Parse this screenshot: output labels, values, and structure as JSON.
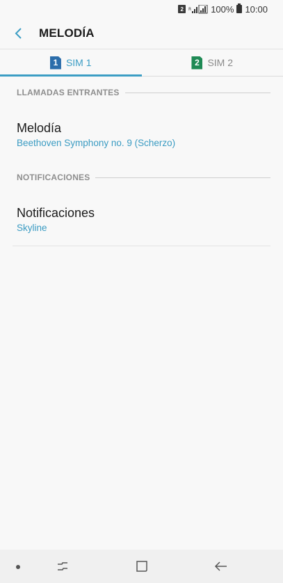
{
  "status_bar": {
    "sim_indicator": "2",
    "battery_percent": "100%",
    "time": "10:00",
    "icons": [
      "sim2-icon",
      "signal-icon",
      "battery-icon"
    ]
  },
  "header": {
    "title": "MELODÍA",
    "back_icon": "back-arrow-icon"
  },
  "tabs": [
    {
      "number": "1",
      "label": "SIM 1",
      "active": true,
      "color": "#2c6eab"
    },
    {
      "number": "2",
      "label": "SIM 2",
      "active": false,
      "color": "#1f8a55"
    }
  ],
  "sections": {
    "incoming": {
      "header": "LLAMADAS ENTRANTES",
      "item_title": "Melodía",
      "item_value": "Beethoven Symphony no. 9 (Scherzo)"
    },
    "notifications": {
      "header": "NOTIFICACIONES",
      "item_title": "Notificaciones",
      "item_value": "Skyline"
    }
  },
  "nav_bar": {
    "icons": [
      "nav-dot-icon",
      "recent-apps-icon",
      "home-icon",
      "back-icon"
    ]
  },
  "colors": {
    "accent": "#3c9dc4",
    "background": "#f8f8f8",
    "sim1": "#2c6eab",
    "sim2": "#1f8a55"
  }
}
